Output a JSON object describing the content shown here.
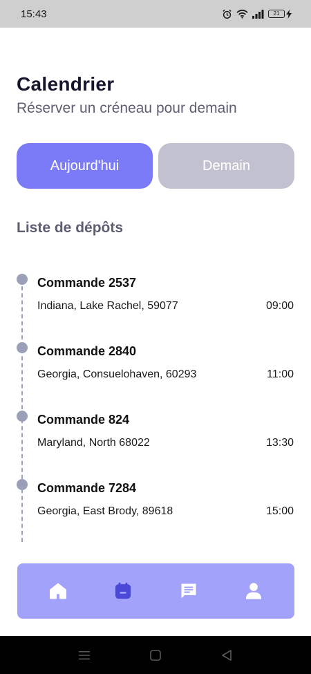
{
  "status_bar": {
    "time": "15:43",
    "battery": "21"
  },
  "header": {
    "title": "Calendrier",
    "subtitle": "Réserver un créneau pour demain"
  },
  "day_toggle": {
    "today_label": "Aujourd'hui",
    "tomorrow_label": "Demain",
    "selected": "today"
  },
  "list": {
    "title": "Liste de dépôts",
    "items": [
      {
        "title": "Commande 2537",
        "address": "Indiana, Lake Rachel, 59077",
        "time": "09:00"
      },
      {
        "title": "Commande 2840",
        "address": "Georgia, Consuelohaven, 60293",
        "time": "11:00"
      },
      {
        "title": "Commande 824",
        "address": "Maryland, North 68022",
        "time": "13:30"
      },
      {
        "title": "Commande 7284",
        "address": "Georgia, East Brody, 89618",
        "time": "15:00"
      }
    ]
  },
  "bottom_nav": {
    "items": [
      {
        "icon": "home-icon",
        "active": false
      },
      {
        "icon": "calendar-icon",
        "active": true
      },
      {
        "icon": "chat-icon",
        "active": false
      },
      {
        "icon": "user-icon",
        "active": false
      }
    ]
  },
  "colors": {
    "accent": "#7c7bf7",
    "inactive_button": "#c2c1cf",
    "nav_background": "#a3a2fb",
    "nav_active": "#4a48d6",
    "timeline": "#9aa0b8"
  }
}
